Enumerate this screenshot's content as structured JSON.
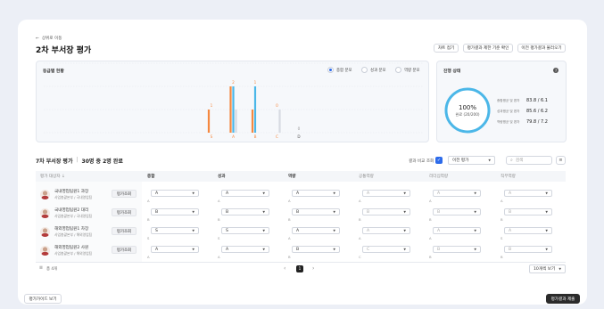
{
  "header": {
    "back_label": "상위로 이동",
    "title": "2차 부서장 평가",
    "actions": [
      "차트 접기",
      "평가결과 제한 기준 확인",
      "이전 평가결과 불러오기"
    ]
  },
  "grade_panel": {
    "title": "등급별 현황",
    "radios": [
      {
        "label": "종합 분포",
        "selected": true
      },
      {
        "label": "성과 분포",
        "selected": false
      },
      {
        "label": "역량 분포",
        "selected": false
      }
    ]
  },
  "chart_data": {
    "type": "bar",
    "categories": [
      "S",
      "A",
      "B",
      "C",
      "D"
    ],
    "series": [
      {
        "color": "#f5883f",
        "values": [
          1,
          2,
          1,
          0,
          0
        ]
      },
      {
        "color": "#4bb7e8",
        "values": [
          0,
          2,
          2,
          0,
          0
        ]
      },
      {
        "color": "#d7dbe2",
        "values": [
          0,
          1,
          0,
          1,
          0
        ]
      }
    ],
    "top_labels": [
      "1",
      "2",
      "1",
      "0",
      "0"
    ],
    "top_label_colors": [
      "#f5883f",
      "#f5883f",
      "#f5883f",
      "#f5883f",
      "#999999"
    ],
    "category_colors": [
      "#f5883f",
      "#f5883f",
      "#f5883f",
      "#f5883f",
      "#555555"
    ]
  },
  "progress_panel": {
    "title": "진행 상태",
    "percent": "100%",
    "count": "완료 (20/200)",
    "ratio": 1.0,
    "stats": [
      {
        "label": "종합평균 및 편차",
        "value": "83.8 / 6.1"
      },
      {
        "label": "성과평균 및 편차",
        "value": "85.6 / 6.2"
      },
      {
        "label": "역량평균 및 편차",
        "value": "79.8 / 7.2"
      }
    ]
  },
  "list": {
    "heading_left": "7차 부서장 평가",
    "heading_right": "30명 중 2명 완료",
    "compare_label": "결과 비교 조회",
    "previous_select": "이전 평가",
    "search_placeholder": "검색",
    "columns": [
      "평가 대상자",
      "종합",
      "성과",
      "역량",
      "공통역량",
      "리더십역량",
      "직무역량"
    ],
    "rows": [
      {
        "name": "국내영업팀원1 과장",
        "dept": "사업총괄본부 / 국내영업팀",
        "action": "평가조회",
        "grades": [
          "A",
          "A",
          "A",
          "A",
          "A",
          "A"
        ],
        "subs": [
          "A",
          "A",
          "A",
          "A",
          "A",
          "A"
        ]
      },
      {
        "name": "국내영업팀원2 대리",
        "dept": "사업총괄본부 / 국내영업팀",
        "action": "평가조회",
        "grades": [
          "B",
          "B",
          "B",
          "B",
          "B",
          "B"
        ],
        "subs": [
          "B",
          "B",
          "B",
          "B",
          "B",
          "B"
        ]
      },
      {
        "name": "해외영업팀원1 차장",
        "dept": "사업총괄본부 / 해외영업팀",
        "action": "평가조회",
        "grades": [
          "S",
          "S",
          "A",
          "A",
          "A",
          "A"
        ],
        "subs": [
          "S",
          "S",
          "A",
          "A",
          "A",
          "S"
        ]
      },
      {
        "name": "해외영업팀원2 사원",
        "dept": "사업총괄본부 / 해외영업팀",
        "action": "평가조회",
        "grades": [
          "A",
          "A",
          "B",
          "C",
          "B",
          "B"
        ],
        "subs": [
          "A",
          "A",
          "B",
          "C",
          "B",
          "B"
        ]
      }
    ],
    "total_label": "총 4개",
    "page": "1",
    "page_size": "10개씩 보기"
  },
  "footer": {
    "guide_button": "평가가이드 보기",
    "submit_button": "평가결과 제출"
  },
  "colors": {
    "accent": "#2d6bea",
    "orange": "#f5883f",
    "blue": "#4bb7e8",
    "dark": "#2b2b2b"
  }
}
